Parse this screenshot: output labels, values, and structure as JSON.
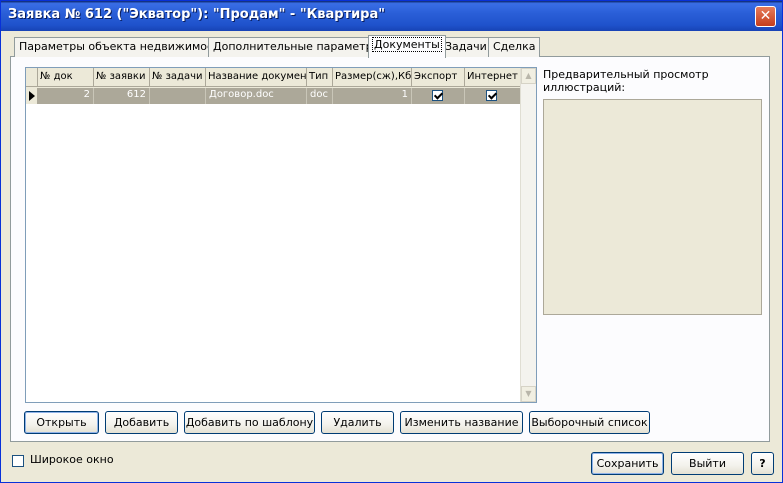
{
  "window": {
    "title": "Заявка № 612 (\"Экватор\"): \"Продам\" - \"Квартира\"",
    "close_glyph": "✕",
    "colors": {
      "titlebar": "#2a5fd8",
      "background": "#ece9d8",
      "selected_row": "#aca899"
    }
  },
  "tabs": [
    {
      "label": "Параметры объекта недвижимости",
      "active": false
    },
    {
      "label": "Дополнительные параметры",
      "active": false
    },
    {
      "label": "Документы",
      "active": true
    },
    {
      "label": "Задачи",
      "active": false
    },
    {
      "label": "Сделка",
      "active": false
    }
  ],
  "grid": {
    "columns": [
      "№ док",
      "№ заявки",
      "№ задачи",
      "Название докумен",
      "Тип",
      "Размер(сж),Кб",
      "Экспорт",
      "Интернет"
    ],
    "rows": [
      {
        "doc_no": "2",
        "request_no": "612",
        "task_no": "",
        "name": "Договор.doc",
        "type": "doc",
        "size_kb": "1",
        "export": true,
        "internet": true,
        "selected": true
      }
    ]
  },
  "preview": {
    "label": "Предварительный просмотр иллюстраций:"
  },
  "buttons": {
    "open": "Открыть",
    "add": "Добавить",
    "add_template": "Добавить по шаблону",
    "delete": "Удалить",
    "rename": "Изменить название",
    "select_list": "Выборочный список",
    "save": "Сохранить",
    "exit": "Выйти",
    "help": "?"
  },
  "options": {
    "wide_window_label": "Широкое окно",
    "wide_window_checked": false
  }
}
